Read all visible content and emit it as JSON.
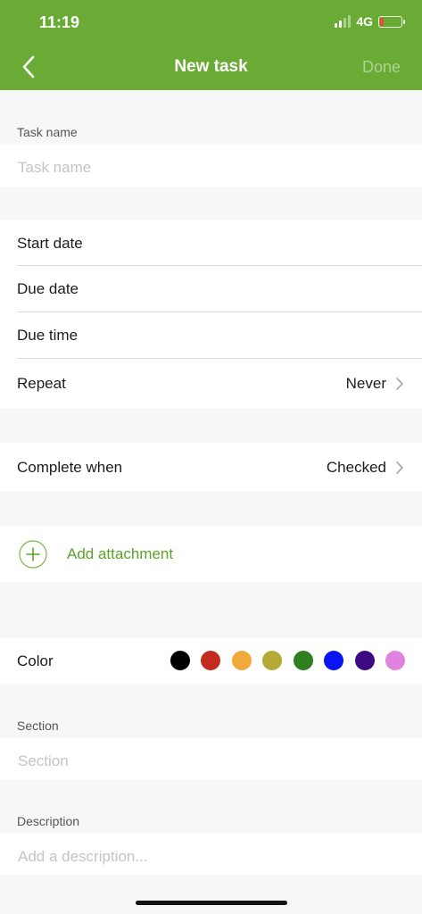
{
  "status_bar": {
    "time": "11:19",
    "network": "4G",
    "battery_level": 0.2,
    "signal_bars_active": 2
  },
  "header": {
    "title": "New task",
    "done_label": "Done",
    "back_icon": "chevron-left-icon"
  },
  "task_name": {
    "label": "Task name",
    "placeholder": "Task name"
  },
  "dates": {
    "start_date": "Start date",
    "due_date": "Due date",
    "due_time": "Due time",
    "repeat_label": "Repeat",
    "repeat_value": "Never"
  },
  "complete": {
    "label": "Complete when",
    "value": "Checked"
  },
  "attachment": {
    "label": "Add attachment",
    "icon": "plus-circle-icon"
  },
  "color": {
    "label": "Color",
    "options": [
      "#000000",
      "#c42b1f",
      "#f2a93b",
      "#b5aa36",
      "#2f7d1f",
      "#0a14f0",
      "#3c0a80",
      "#e082e0"
    ]
  },
  "section": {
    "label": "Section",
    "placeholder": "Section"
  },
  "description": {
    "label": "Description",
    "placeholder": "Add a description..."
  },
  "accent_color": "#6aab35"
}
